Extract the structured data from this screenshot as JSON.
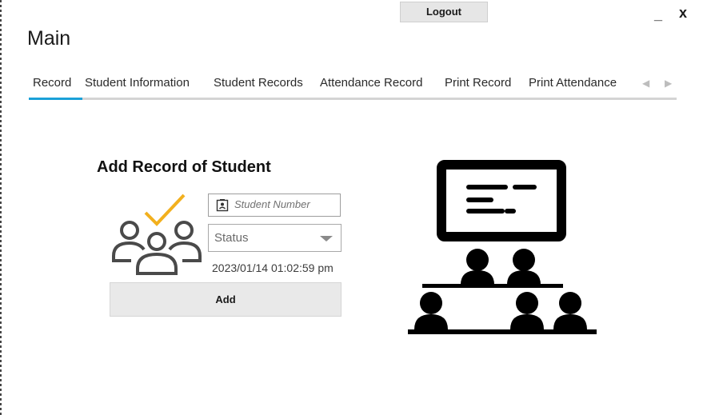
{
  "window": {
    "title": "Main",
    "logout_label": "Logout",
    "minimize_label": "_",
    "close_label": "x"
  },
  "tabs": {
    "items": [
      {
        "label": "Record",
        "active": true
      },
      {
        "label": "Student Information",
        "active": false
      },
      {
        "label": "Student Records",
        "active": false
      },
      {
        "label": "Attendance Record",
        "active": false
      },
      {
        "label": "Print Record",
        "active": false
      },
      {
        "label": "Print Attendance",
        "active": false
      }
    ],
    "prev_glyph": "◀",
    "next_glyph": "▶"
  },
  "form": {
    "heading": "Add Record of Student",
    "student_number_placeholder": "Student Number",
    "status_value": "Status",
    "datetime": "2023/01/14 01:02:59 pm",
    "add_label": "Add"
  },
  "colors": {
    "accent_tab": "#1aa0d8",
    "check_mark": "#f2b01e",
    "icon_dark": "#4a4a4a",
    "classroom": "#000000"
  },
  "icons": {
    "group": "students-check-icon",
    "id_card": "id-card-icon",
    "classroom": "classroom-icon"
  }
}
